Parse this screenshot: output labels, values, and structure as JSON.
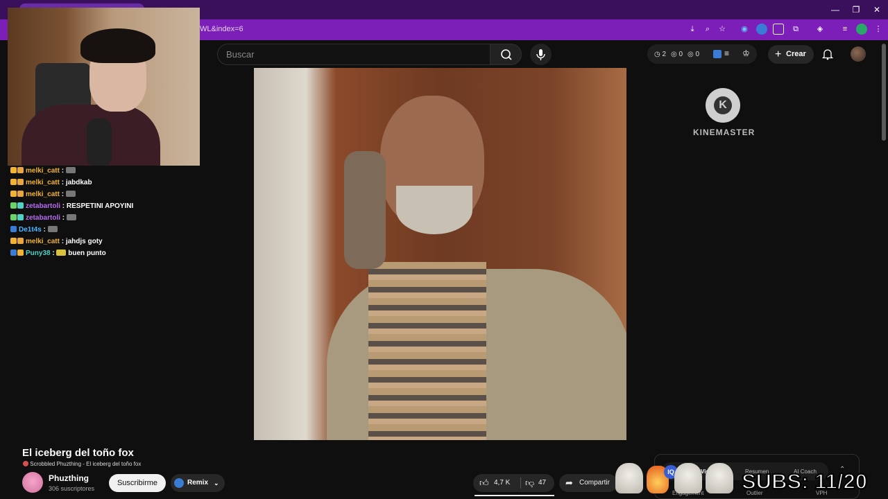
{
  "browser": {
    "url_fragment": "WL&index=6"
  },
  "header": {
    "search_placeholder": "Buscar",
    "stats": {
      "comments": "2",
      "views": "0",
      "likes": "0"
    },
    "create_label": "Crear"
  },
  "chat": [
    {
      "user": "melki_catt",
      "color": "#f2b233",
      "message": ""
    },
    {
      "user": "melki_catt",
      "color": "#f2b233",
      "message": "jabdkab"
    },
    {
      "user": "melki_catt",
      "color": "#f2b233",
      "message": ""
    },
    {
      "user": "zetabartoli",
      "color": "#b76cf0",
      "message": "RESPETINI APOYINI"
    },
    {
      "user": "zetabartoli",
      "color": "#b76cf0",
      "message": ""
    },
    {
      "user": "De1t4s",
      "color": "#4db8ff",
      "message": ""
    },
    {
      "user": "melki_catt",
      "color": "#f2b233",
      "message": "jahdjs goty"
    },
    {
      "user": "Puny38",
      "color": "#4fd1c5",
      "message": "buen punto"
    }
  ],
  "video": {
    "watermark": "KINEMASTER",
    "title": "El iceberg del toño fox",
    "scrobble": "Scrobbled Phuzthing - El iceberg del toño fox"
  },
  "channel": {
    "name": "Phuzthing",
    "subscribers": "306 suscriptores",
    "subscribe_label": "Suscribirme",
    "remix_label": "Remix"
  },
  "actions": {
    "likes": "4,7 K",
    "dislikes": "47",
    "share_label": "Compartir"
  },
  "extension_panel": {
    "tabs": [
      "Vist",
      "Resumen",
      "AI Coach"
    ],
    "footer": [
      "Engagement",
      "Outlier",
      "VPH"
    ]
  },
  "overlay": {
    "subs_text": "SUBS: 11/20"
  },
  "colors": {
    "titlebar": "#3a0f5c",
    "addressbar": "#7b1fb8",
    "background": "#0f0f0f"
  }
}
